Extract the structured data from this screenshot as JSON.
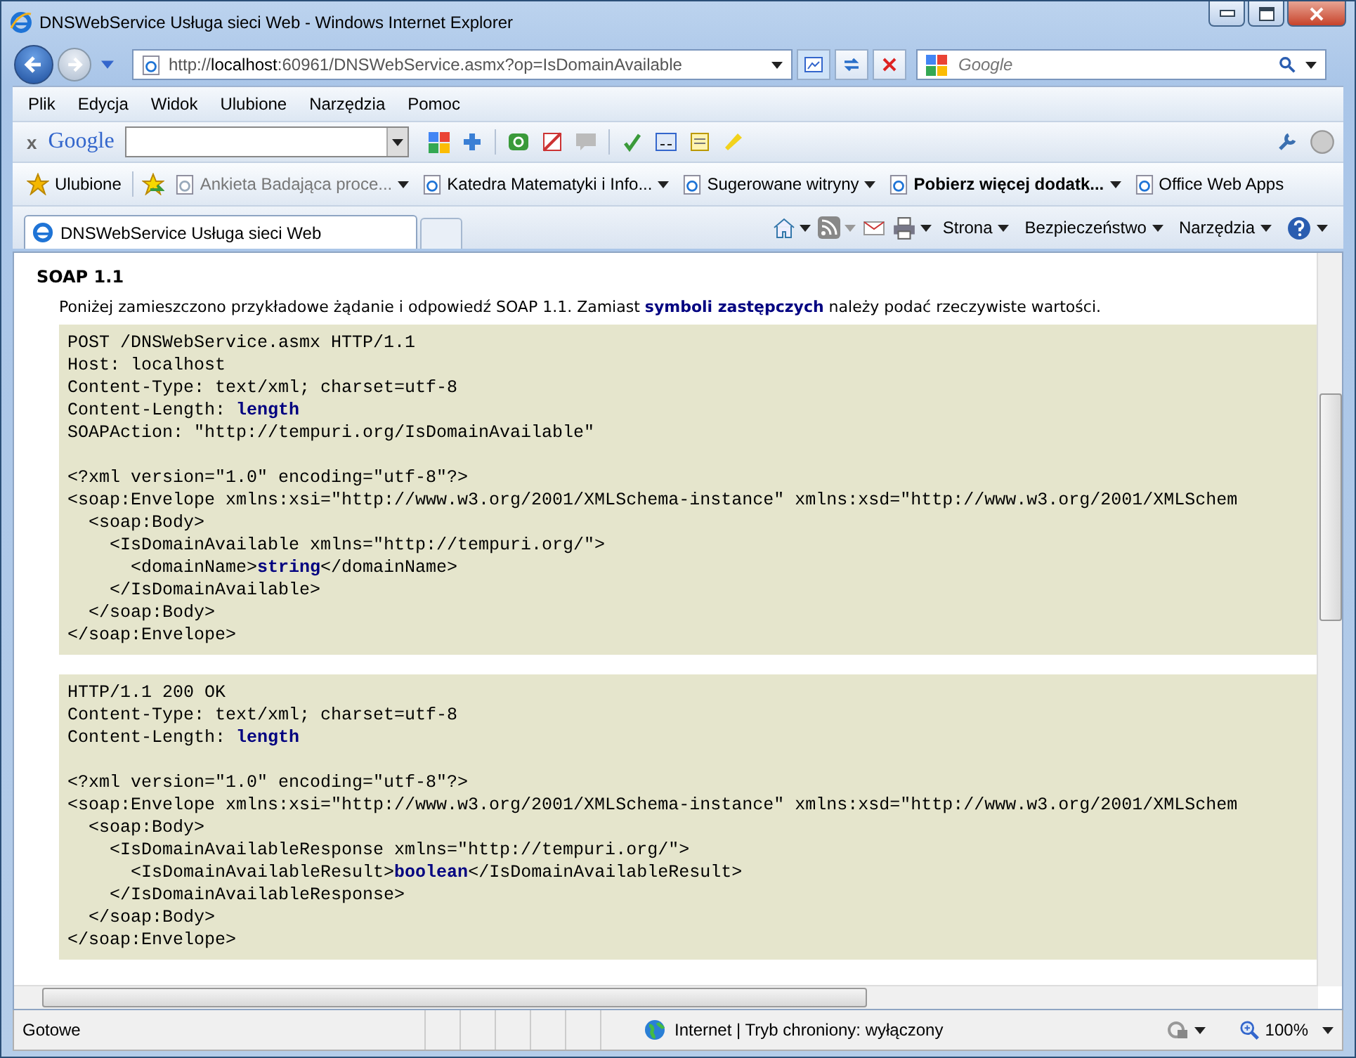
{
  "window": {
    "title": "DNSWebService Usługa sieci Web - Windows Internet Explorer"
  },
  "address": {
    "url": "http://**localhost**:60961/DNSWebService.asmx?op=IsDomainAvailable"
  },
  "search": {
    "placeholder": "Google"
  },
  "menu": [
    "Plik",
    "Edycja",
    "Widok",
    "Ulubione",
    "Narzędzia",
    "Pomoc"
  ],
  "google_toolbar": {
    "close": "x",
    "logo": "Google"
  },
  "favorites": {
    "label": "Ulubione",
    "items": [
      {
        "label": "Ankieta Badająca proce...",
        "dimmed": true,
        "bold": false,
        "menu": true
      },
      {
        "label": "Katedra Matematyki i Info...",
        "dimmed": false,
        "bold": false,
        "menu": true
      },
      {
        "label": "Sugerowane witryny",
        "dimmed": false,
        "bold": false,
        "menu": true
      },
      {
        "label": "Pobierz więcej dodatk...",
        "dimmed": false,
        "bold": true,
        "menu": true
      },
      {
        "label": "Office Web Apps",
        "dimmed": false,
        "bold": false,
        "menu": false
      }
    ]
  },
  "tab": {
    "title": "DNSWebService Usługa sieci Web"
  },
  "commands": [
    "Strona",
    "Bezpieczeństwo",
    "Narzędzia"
  ],
  "content": {
    "heading": "SOAP 1.1",
    "intro": "Poniżej zamieszczono przykładowe żądanie i odpowiedź SOAP 1.1. Zamiast **symboli zastępczych** należy podać rzeczywiste wartości.",
    "blocks": [
      [
        [
          "POST /DNSWebService.asmx HTTP/1.1",
          "Host: localhost",
          "Content-Type: text/xml; charset=utf-8",
          "Content-Length: **length**",
          "SOAPAction: \"http://tempuri.org/IsDomainAvailable\""
        ],
        [
          "<?xml version=\"1.0\" encoding=\"utf-8\"?>",
          "<soap:Envelope xmlns:xsi=\"http://www.w3.org/2001/XMLSchema-instance\" xmlns:xsd=\"http://www.w3.org/2001/XMLSchem",
          "  <soap:Body>",
          "    <IsDomainAvailable xmlns=\"http://tempuri.org/\">",
          "      <domainName>**string**</domainName>",
          "    </IsDomainAvailable>",
          "  </soap:Body>",
          "</soap:Envelope>"
        ]
      ],
      [
        [
          "HTTP/1.1 200 OK",
          "Content-Type: text/xml; charset=utf-8",
          "Content-Length: **length**"
        ],
        [
          "<?xml version=\"1.0\" encoding=\"utf-8\"?>",
          "<soap:Envelope xmlns:xsi=\"http://www.w3.org/2001/XMLSchema-instance\" xmlns:xsd=\"http://www.w3.org/2001/XMLSchem",
          "  <soap:Body>",
          "    <IsDomainAvailableResponse xmlns=\"http://tempuri.org/\">",
          "      <IsDomainAvailableResult>**boolean**</IsDomainAvailableResult>",
          "    </IsDomainAvailableResponse>",
          "  </soap:Body>",
          "</soap:Envelope>"
        ]
      ]
    ]
  },
  "status": {
    "text": "Gotowe",
    "zone": "Internet | Tryb chroniony: wyłączony",
    "zoom": "100%"
  }
}
